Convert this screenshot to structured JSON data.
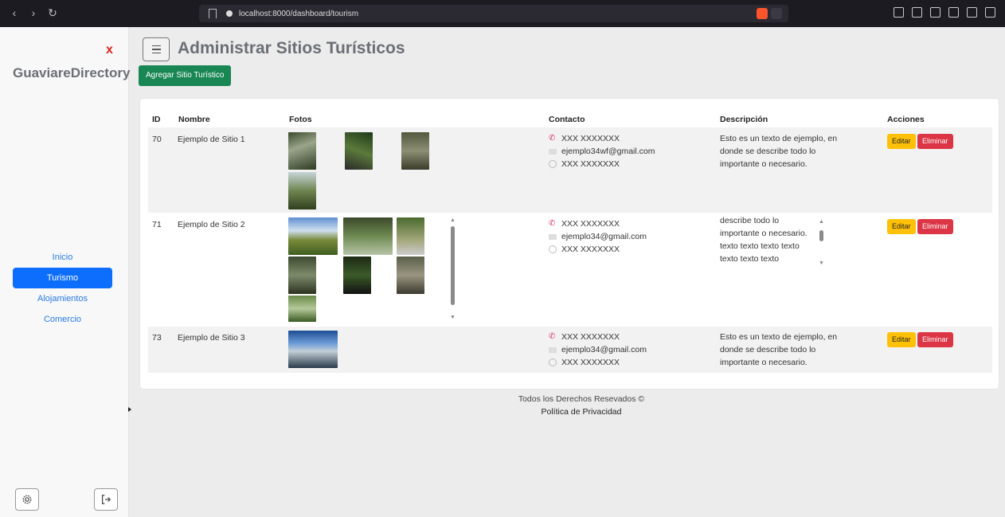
{
  "browser": {
    "url": "localhost:8000/dashboard/tourism"
  },
  "sidebar": {
    "close_label": "x",
    "brand": "GuaviareDirectory",
    "items": [
      {
        "label": "Inicio",
        "active": false
      },
      {
        "label": "Turismo",
        "active": true
      },
      {
        "label": "Alojamientos",
        "active": false
      },
      {
        "label": "Comercio",
        "active": false
      }
    ],
    "settings_icon": "gear-icon",
    "logout_icon": "logout-icon"
  },
  "header": {
    "title": "Administrar Sitios Turísticos",
    "add_button": "Agregar Sitio Turístico"
  },
  "table": {
    "columns": [
      "ID",
      "Nombre",
      "Fotos",
      "Contacto",
      "Descripción",
      "Acciones"
    ],
    "rows": [
      {
        "id": "70",
        "name": "Ejemplo de Sitio 1",
        "phone": "XXX XXXXXXX",
        "email": "ejemplo34wf@gmail.com",
        "whatsapp": "XXX XXXXXXX",
        "description": "Esto es un texto de ejemplo, en donde se describe todo lo importante o necesario.",
        "edit": "Editar",
        "delete": "Eliminar"
      },
      {
        "id": "71",
        "name": "Ejemplo de Sitio 2",
        "phone": "XXX XXXXXXX",
        "email": "ejemplo34@gmail.com",
        "whatsapp": "XXX XXXXXXX",
        "description": "describe todo lo importante o necesario. texto texto texto texto texto texto texto",
        "edit": "Editar",
        "delete": "Eliminar"
      },
      {
        "id": "73",
        "name": "Ejemplo de Sitio 3",
        "phone": "XXX XXXXXXX",
        "email": "ejemplo34@gmail.com",
        "whatsapp": "XXX XXXXXXX",
        "description": "Esto es un texto de ejemplo, en donde se describe todo lo importante o necesario.",
        "edit": "Editar",
        "delete": "Eliminar"
      }
    ]
  },
  "footer": {
    "rights": "Todos los Derechos Resevados ©",
    "privacy": "Política de Privacidad"
  },
  "colors": {
    "primary": "#0d6efd",
    "success": "#198754",
    "warning": "#ffc107",
    "danger": "#dc3545",
    "phone_icon": "#d6336c"
  }
}
